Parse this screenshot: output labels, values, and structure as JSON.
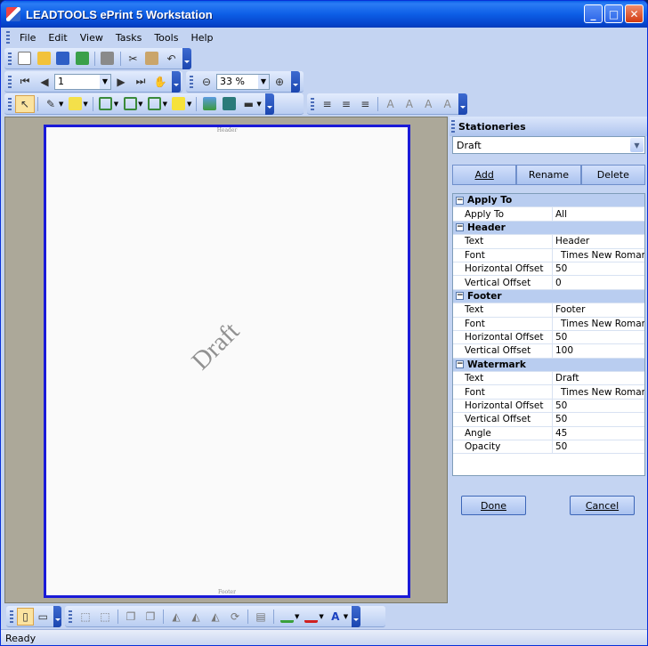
{
  "window": {
    "title": "LEADTOOLS ePrint 5 Workstation"
  },
  "menu": [
    "File",
    "Edit",
    "View",
    "Tasks",
    "Tools",
    "Help"
  ],
  "navbar": {
    "page_value": "1",
    "zoom_value": "33 %"
  },
  "document": {
    "header_text": "Header",
    "footer_text": "Footer",
    "watermark_text": "Draft"
  },
  "panel": {
    "title": "Stationeries",
    "selected": "Draft",
    "buttons": {
      "add": "Add",
      "rename": "Rename",
      "delete": "Delete"
    },
    "groups": [
      {
        "name": "Apply To",
        "rows": [
          {
            "label": "Apply To",
            "value": "All"
          }
        ]
      },
      {
        "name": "Header",
        "rows": [
          {
            "label": "Text",
            "value": "Header"
          },
          {
            "label": "Font",
            "value": "Times New Roman",
            "swatch": "#000000"
          },
          {
            "label": "Horizontal Offset",
            "value": "50"
          },
          {
            "label": "Vertical Offset",
            "value": "0"
          }
        ]
      },
      {
        "name": "Footer",
        "rows": [
          {
            "label": "Text",
            "value": "Footer"
          },
          {
            "label": "Font",
            "value": "Times New Roman",
            "swatch": "#000000"
          },
          {
            "label": "Horizontal Offset",
            "value": "50"
          },
          {
            "label": "Vertical Offset",
            "value": "100"
          }
        ]
      },
      {
        "name": "Watermark",
        "rows": [
          {
            "label": "Text",
            "value": "Draft"
          },
          {
            "label": "Font",
            "value": "Times New Roman",
            "swatch": "#000000"
          },
          {
            "label": "Horizontal Offset",
            "value": "50"
          },
          {
            "label": "Vertical Offset",
            "value": "50"
          },
          {
            "label": "Angle",
            "value": "45"
          },
          {
            "label": "Opacity",
            "value": "50"
          }
        ]
      }
    ],
    "done_label": "Done",
    "cancel_label": "Cancel"
  },
  "status": "Ready"
}
